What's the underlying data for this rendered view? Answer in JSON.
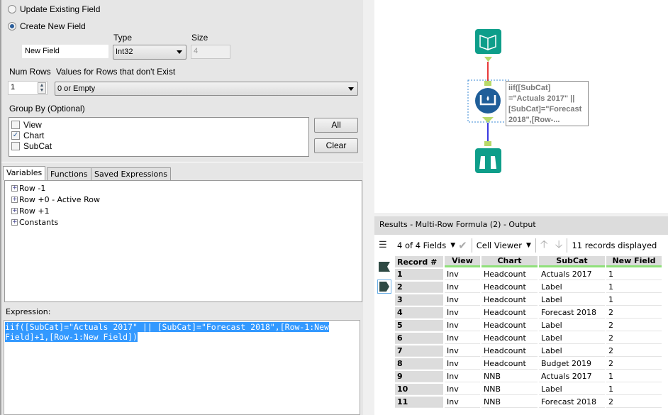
{
  "config": {
    "update_existing_label": "Update Existing Field",
    "create_new_label": "Create New  Field",
    "type_label": "Type",
    "size_label": "Size",
    "new_field_name": "New Field",
    "type_value": "Int32",
    "size_value": "4",
    "num_rows_label": "Num Rows",
    "values_label": "Values for Rows that don't Exist",
    "num_rows_value": "1",
    "values_option": "0 or Empty",
    "group_by_label": "Group By (Optional)",
    "group_by_items": [
      {
        "label": "View",
        "checked": false
      },
      {
        "label": "Chart",
        "checked": true
      },
      {
        "label": "SubCat",
        "checked": false
      }
    ],
    "all_button": "All",
    "clear_button": "Clear"
  },
  "tabs": [
    "Variables",
    "Functions",
    "Saved Expressions"
  ],
  "variables": [
    "Row -1",
    "Row +0 - Active Row",
    "Row +1",
    "Constants"
  ],
  "expression": {
    "label": "Expression:",
    "line1": "iif([SubCat]=\"Actuals 2017\" || [SubCat]=\"Forecast 2018\",[Row-1:New ",
    "line2": "Field]+1,[Row-1:New Field]) "
  },
  "canvas": {
    "annotation": [
      "iif([SubCat]",
      "=\"Actuals 2017\" ||",
      "[SubCat]=\"Forecast",
      "2018\",[Row-..."
    ],
    "tool_colors": {
      "input": "#0e9e8a",
      "formula": "#1f5e99",
      "browse": "#0e9e8a"
    }
  },
  "results": {
    "title": "Results - Multi-Row Formula (2) - Output",
    "fields_selector": "4 of 4 Fields",
    "cell_viewer": "Cell Viewer",
    "records_displayed": "11 records displayed",
    "columns": [
      "Record #",
      "View",
      "Chart",
      "SubCat",
      "New Field"
    ],
    "rows": [
      [
        "1",
        "Inv",
        "Headcount",
        "Actuals 2017",
        "1"
      ],
      [
        "2",
        "Inv",
        "Headcount",
        "Label",
        "1"
      ],
      [
        "3",
        "Inv",
        "Headcount",
        "Label",
        "1"
      ],
      [
        "4",
        "Inv",
        "Headcount",
        "Forecast 2018",
        "2"
      ],
      [
        "5",
        "Inv",
        "Headcount",
        "Label",
        "2"
      ],
      [
        "6",
        "Inv",
        "Headcount",
        "Label",
        "2"
      ],
      [
        "7",
        "Inv",
        "Headcount",
        "Label",
        "2"
      ],
      [
        "8",
        "Inv",
        "Headcount",
        "Budget 2019",
        "2"
      ],
      [
        "9",
        "Inv",
        "NNB",
        "Actuals 2017",
        "1"
      ],
      [
        "10",
        "Inv",
        "NNB",
        "Label",
        "1"
      ],
      [
        "11",
        "Inv",
        "NNB",
        "Forecast 2018",
        "2"
      ]
    ]
  }
}
